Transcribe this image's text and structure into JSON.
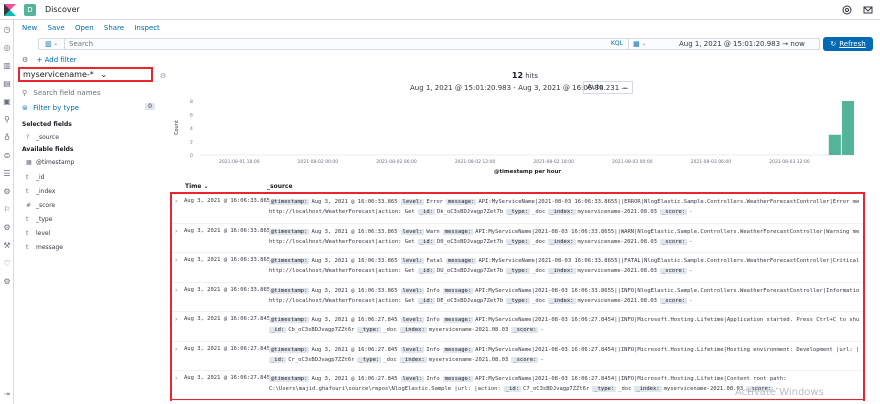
{
  "header": {
    "app_title": "Discover",
    "space_initial": "D"
  },
  "menu": [
    "New",
    "Save",
    "Open",
    "Share",
    "Inspect"
  ],
  "query": {
    "placeholder": "Search",
    "language": "KQL",
    "time_range": "Aug 1, 2021 @ 15:01:20.983  →  now",
    "refresh_label": "Refresh"
  },
  "filters": {
    "add_label": "+ Add filter"
  },
  "sidebar": {
    "index_pattern": "myservicename-*",
    "search_placeholder": "Search field names",
    "filter_by_type": "Filter by type",
    "filter_count": "0",
    "selected_title": "Selected fields",
    "selected_fields": [
      {
        "type": "?",
        "name": "_source"
      }
    ],
    "available_title": "Available fields",
    "available_fields": [
      {
        "type": "▦",
        "name": "@timestamp"
      },
      {
        "type": "t",
        "name": "_id"
      },
      {
        "type": "t",
        "name": "_index"
      },
      {
        "type": "#",
        "name": "_score"
      },
      {
        "type": "t",
        "name": "_type"
      },
      {
        "type": "t",
        "name": "level"
      },
      {
        "type": "t",
        "name": "message"
      }
    ]
  },
  "hits": {
    "count": "12",
    "label": "hits",
    "range": "Aug 1, 2021 @ 15:01:20.983 - Aug 3, 2021 @ 16:06:36.231 —",
    "interval": "Auto"
  },
  "chart_data": {
    "type": "bar",
    "title": "",
    "xlabel": "@timestamp per hour",
    "ylabel": "Count",
    "ylim": [
      0,
      8
    ],
    "y_ticks": [
      0,
      2,
      4,
      6,
      8
    ],
    "x_ticks": [
      "2021-08-01 18:00",
      "2021-08-02 00:00",
      "2021-08-02 06:00",
      "2021-08-02 12:00",
      "2021-08-02 18:00",
      "2021-08-03 00:00",
      "2021-08-03 06:00",
      "2021-08-03 12:00"
    ],
    "x_range": [
      "2021-08-01 15:00",
      "2021-08-03 17:00"
    ],
    "categories": [
      "2021-08-03 15:00",
      "2021-08-03 16:00"
    ],
    "values": [
      3,
      9
    ],
    "color": "#54b399"
  },
  "table": {
    "col_time": "Time ⌄",
    "col_source": "_source",
    "rows": [
      {
        "time": "Aug 3, 2021 @ 16:06:33.865",
        "lines": [
          [
            [
              "@timestamp:",
              "Aug 3, 2021 @ 16:06:33.865"
            ],
            [
              "level:",
              "Error"
            ],
            [
              "message:",
              "API:MyServiceName|2021-08-03 16:06:33.8655||ERROR|NlogElastic.Sample.Controllers.WeatherForecastController|Error message |url:"
            ]
          ],
          [
            [
              "",
              "http://localhost/WeatherForecast|action: Get"
            ],
            [
              "_id:",
              "Dk_oC3sBDJvagp7Zet7b"
            ],
            [
              "_type:",
              "_doc"
            ],
            [
              "_index:",
              "myservicename-2021.08.03"
            ],
            [
              "_score:",
              "-"
            ]
          ]
        ]
      },
      {
        "time": "Aug 3, 2021 @ 16:06:33.865",
        "lines": [
          [
            [
              "@timestamp:",
              "Aug 3, 2021 @ 16:06:33.865"
            ],
            [
              "level:",
              "Warn"
            ],
            [
              "message:",
              "API:MyServiceName|2021-08-03 16:06:33.8655||WARN|NlogElastic.Sample.Controllers.WeatherForecastController|Warning message |url:"
            ]
          ],
          [
            [
              "",
              "http://localhost/WeatherForecast|action: Get"
            ],
            [
              "_id:",
              "D0_oC3sBDJvagp7Zet7b"
            ],
            [
              "_type:",
              "_doc"
            ],
            [
              "_index:",
              "myservicename-2021.08.03"
            ],
            [
              "_score:",
              "-"
            ]
          ]
        ]
      },
      {
        "time": "Aug 3, 2021 @ 16:06:33.865",
        "lines": [
          [
            [
              "@timestamp:",
              "Aug 3, 2021 @ 16:06:33.865"
            ],
            [
              "level:",
              "Fatal"
            ],
            [
              "message:",
              "API:MyServiceName|2021-08-03 16:06:33.8655||FATAL|NlogElastic.Sample.Controllers.WeatherForecastController|Critical message |url:"
            ]
          ],
          [
            [
              "",
              "http://localhost/WeatherForecast|action: Get"
            ],
            [
              "_id:",
              "DU_oC3sBDJvagp7Zet7b"
            ],
            [
              "_type:",
              "_doc"
            ],
            [
              "_index:",
              "myservicename-2021.08.03"
            ],
            [
              "_score:",
              "-"
            ]
          ]
        ]
      },
      {
        "time": "Aug 3, 2021 @ 16:06:33.865",
        "lines": [
          [
            [
              "@timestamp:",
              "Aug 3, 2021 @ 16:06:33.865"
            ],
            [
              "level:",
              "Info"
            ],
            [
              "message:",
              "API:MyServiceName|2021-08-03 16:06:33.8655||INFO|NlogElastic.Sample.Controllers.WeatherForecastController|Information message |url:"
            ]
          ],
          [
            [
              "",
              "http://localhost/WeatherForecast|action: Get"
            ],
            [
              "_id:",
              "DE_oC3sBDJvagp7Zet7b"
            ],
            [
              "_type:",
              "_doc"
            ],
            [
              "_index:",
              "myservicename-2021.08.03"
            ],
            [
              "_score:",
              "-"
            ]
          ]
        ]
      },
      {
        "time": "Aug 3, 2021 @ 16:06:27.845",
        "lines": [
          [
            [
              "@timestamp:",
              "Aug 3, 2021 @ 16:06:27.845"
            ],
            [
              "level:",
              "Info"
            ],
            [
              "message:",
              "API:MyServiceName|2021-08-03 16:06:27.8454||INFO|Microsoft.Hosting.Lifetime|Application started. Press Ctrl+C to shut down. |url: |action:"
            ]
          ],
          [
            [
              "_id:",
              "Cb_oC3sBDJvagp7ZZt6r"
            ],
            [
              "_type:",
              "_doc"
            ],
            [
              "_index:",
              "myservicename-2021.08.03"
            ],
            [
              "_score:",
              "-"
            ]
          ]
        ]
      },
      {
        "time": "Aug 3, 2021 @ 16:06:27.845",
        "lines": [
          [
            [
              "@timestamp:",
              "Aug 3, 2021 @ 16:06:27.845"
            ],
            [
              "level:",
              "Info"
            ],
            [
              "message:",
              "API:MyServiceName|2021-08-03 16:06:27.8454||INFO|Microsoft.Hosting.Lifetime|Hosting environment: Development |url: |action:"
            ]
          ],
          [
            [
              "_id:",
              "Cr_oC3sBDJvagp7ZZt6r"
            ],
            [
              "_type:",
              "_doc"
            ],
            [
              "_index:",
              "myservicename-2021.08.03"
            ],
            [
              "_score:",
              "-"
            ]
          ]
        ]
      },
      {
        "time": "Aug 3, 2021 @ 16:06:27.845",
        "lines": [
          [
            [
              "@timestamp:",
              "Aug 3, 2021 @ 16:06:27.845"
            ],
            [
              "level:",
              "Info"
            ],
            [
              "message:",
              "API:MyServiceName|2021-08-03 16:06:27.8454||INFO|Microsoft.Hosting.Lifetime|Content root path:"
            ]
          ],
          [
            [
              "",
              "C:\\Users\\majid.ghafouri\\source\\repos\\NlogElastic.Sample |url: |action:"
            ],
            [
              "_id:",
              "C7_oC3sBDJvagp7ZZt6r"
            ],
            [
              "_type:",
              "_doc"
            ],
            [
              "_index:",
              "myservicename-2021.08.03"
            ],
            [
              "_score:",
              "-"
            ]
          ]
        ]
      }
    ]
  },
  "watermark": "Activate Windows",
  "icons": [
    "elastic-logo",
    "help-icon",
    "mail-icon",
    "calendar-icon",
    "refresh-icon",
    "gear-icon",
    "search-icon"
  ],
  "colors": {
    "accent": "#006bb4",
    "highlight": "#e7262d",
    "bar": "#54b399"
  }
}
